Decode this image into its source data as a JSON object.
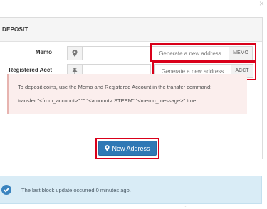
{
  "dialog": {
    "close_label": "×"
  },
  "panel": {
    "title": "DEPOSIT"
  },
  "memo": {
    "label": "Memo",
    "icon": "map-marker-icon",
    "value": "",
    "generate_placeholder": "Generate a new address",
    "addon": "MEMO"
  },
  "account": {
    "label": "Registered Acct",
    "icon": "pushpin-icon",
    "value": "",
    "generate_placeholder": "Generate a new address",
    "addon": "ACCT"
  },
  "info": {
    "line1": "To deposit coins, use the Memo and Registered Account in the transfer command:",
    "line2": "transfer \"<from_account>\" \"\" \"<amount> STEEM\" \"<memo_message>\" true"
  },
  "new_address_button": {
    "label": "New Address",
    "icon": "map-marker-icon"
  },
  "status": {
    "icon": "check-circle-icon",
    "text": "The last block update occurred 0 minutes ago."
  },
  "footer_faint": "...",
  "colors": {
    "highlight": "#d9001a",
    "button": "#2f78b5",
    "status_bg": "#d9ecf6",
    "info_bg": "#fbeeed"
  }
}
